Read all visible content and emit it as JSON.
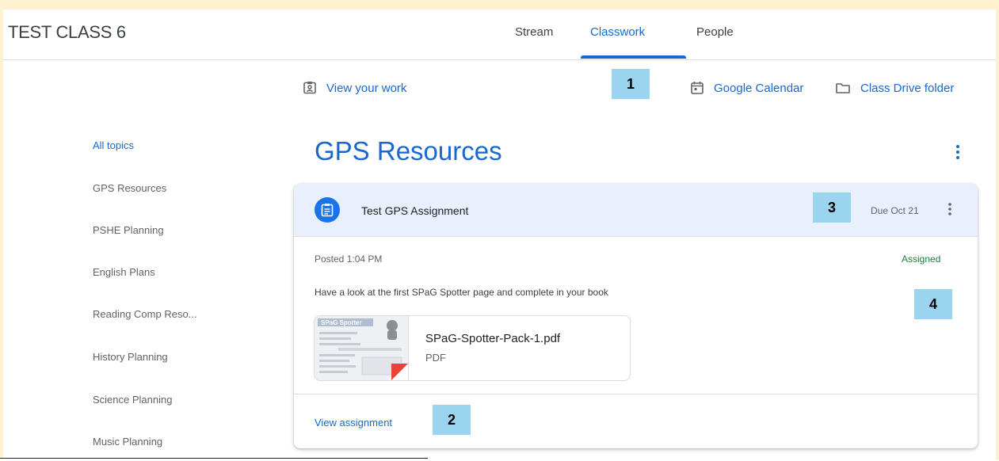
{
  "header": {
    "class_title": "TEST CLASS 6",
    "tabs": [
      {
        "label": "Stream"
      },
      {
        "label": "Classwork",
        "active": true
      },
      {
        "label": "People"
      }
    ]
  },
  "actions": {
    "view_work": "View your work",
    "google_calendar": "Google Calendar",
    "drive_folder": "Class Drive folder"
  },
  "callouts": [
    "1",
    "2",
    "3",
    "4"
  ],
  "sidebar": {
    "items": [
      {
        "label": "All topics",
        "active": true
      },
      {
        "label": "GPS Resources"
      },
      {
        "label": "PSHE Planning"
      },
      {
        "label": "English Plans"
      },
      {
        "label": "Reading Comp Reso..."
      },
      {
        "label": "History Planning"
      },
      {
        "label": "Science Planning"
      },
      {
        "label": "Music Planning"
      }
    ]
  },
  "topic": {
    "title": "GPS Resources"
  },
  "assignment": {
    "title": "Test GPS Assignment",
    "due": "Due Oct 21",
    "posted": "Posted 1:04 PM",
    "status": "Assigned",
    "instructions": "Have a look at the first SPaG Spotter page and complete in your book",
    "attachment": {
      "name": "SPaG-Spotter-Pack-1.pdf",
      "type": "PDF",
      "thumb_heading": "SPaG Spotter"
    },
    "view_label": "View assignment"
  },
  "icons": {
    "view_work": "id-badge-icon",
    "calendar": "calendar-icon",
    "drive": "folder-icon",
    "assignment": "assignment-icon",
    "more": "more-vert-icon"
  },
  "colors": {
    "accent": "#1967d2",
    "header_bg": "#e8f0fe",
    "assigned": "#188038",
    "callout": "#9bd4ef",
    "page_frame": "#fdf1cf"
  }
}
